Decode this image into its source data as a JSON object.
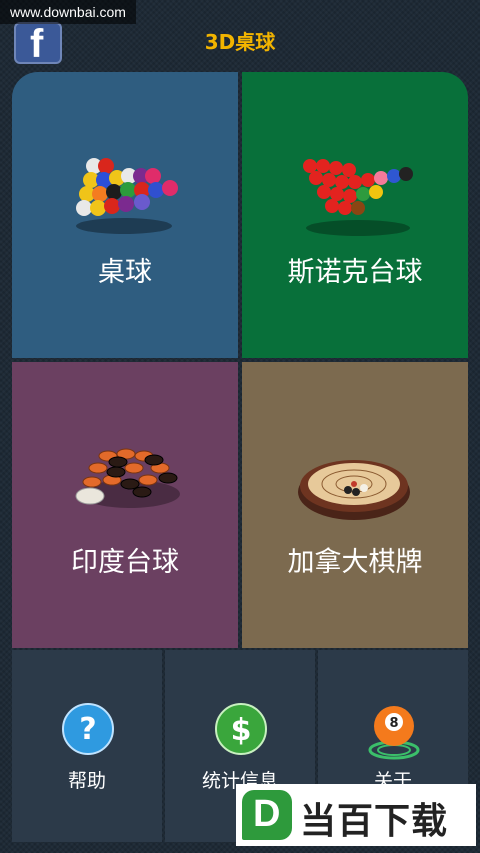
{
  "watermark_top": "www.downbai.com",
  "header": {
    "title": "3D桌球",
    "facebook_glyph": "f"
  },
  "games": [
    {
      "label": "桌球",
      "icon": "pool-balls-icon",
      "color": "#2f5d80"
    },
    {
      "label": "斯诺克台球",
      "icon": "snooker-balls-icon",
      "color": "#08703a"
    },
    {
      "label": "印度台球",
      "icon": "carrom-pieces-icon",
      "color": "#6b4061"
    },
    {
      "label": "加拿大棋牌",
      "icon": "crokinole-board-icon",
      "color": "#7c6a4f"
    }
  ],
  "bottom": [
    {
      "label": "帮助",
      "icon": "help-icon",
      "glyph": "?"
    },
    {
      "label": "统计信息",
      "icon": "dollar-icon",
      "glyph": "$"
    },
    {
      "label": "关于",
      "icon": "about-ball-icon",
      "glyph": "8"
    }
  ],
  "watermark_bottom": {
    "logo": "D",
    "text": "当百下载"
  }
}
